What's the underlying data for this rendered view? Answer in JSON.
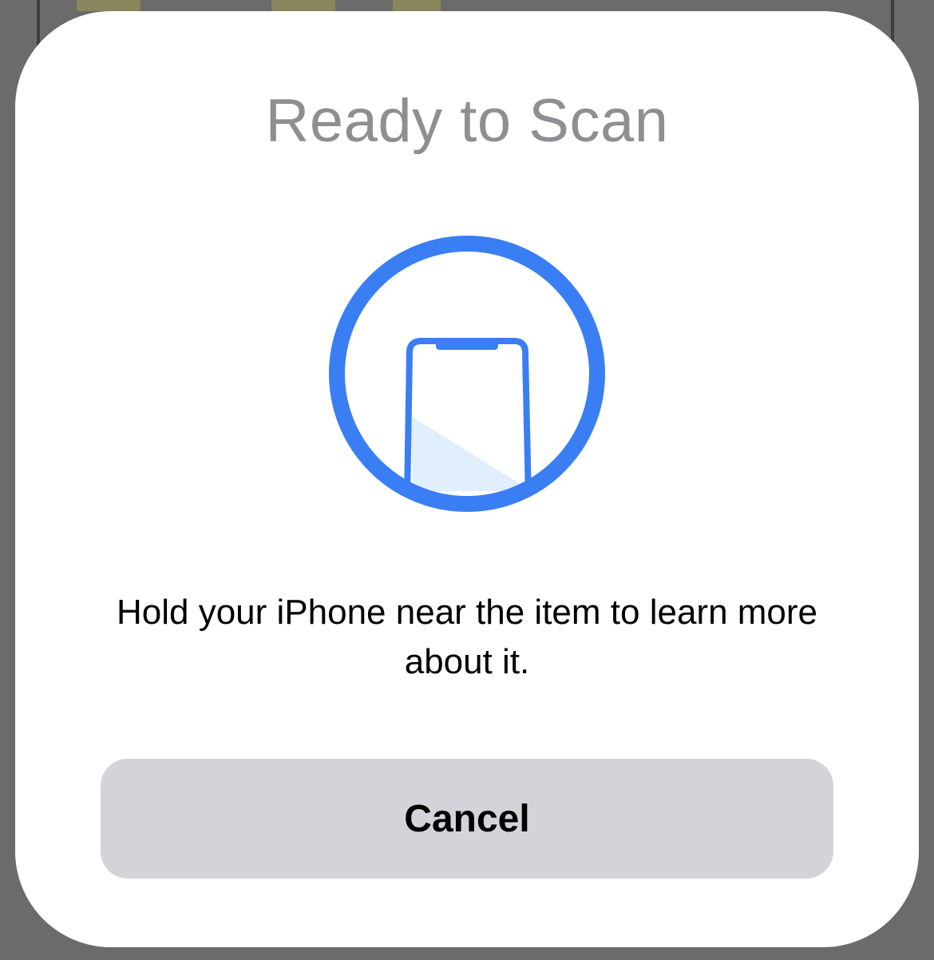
{
  "sheet": {
    "title": "Ready to Scan",
    "message": "Hold your iPhone near the item to learn more about it.",
    "cancel_label": "Cancel",
    "graphic_icon": "phone-scan-icon"
  },
  "colors": {
    "accent": "#3a7ef4",
    "accent_fill": "#e1eefc",
    "title_gray": "#8e8e93",
    "button_bg": "#d3d3d9",
    "backdrop": "#6b6b6b"
  }
}
